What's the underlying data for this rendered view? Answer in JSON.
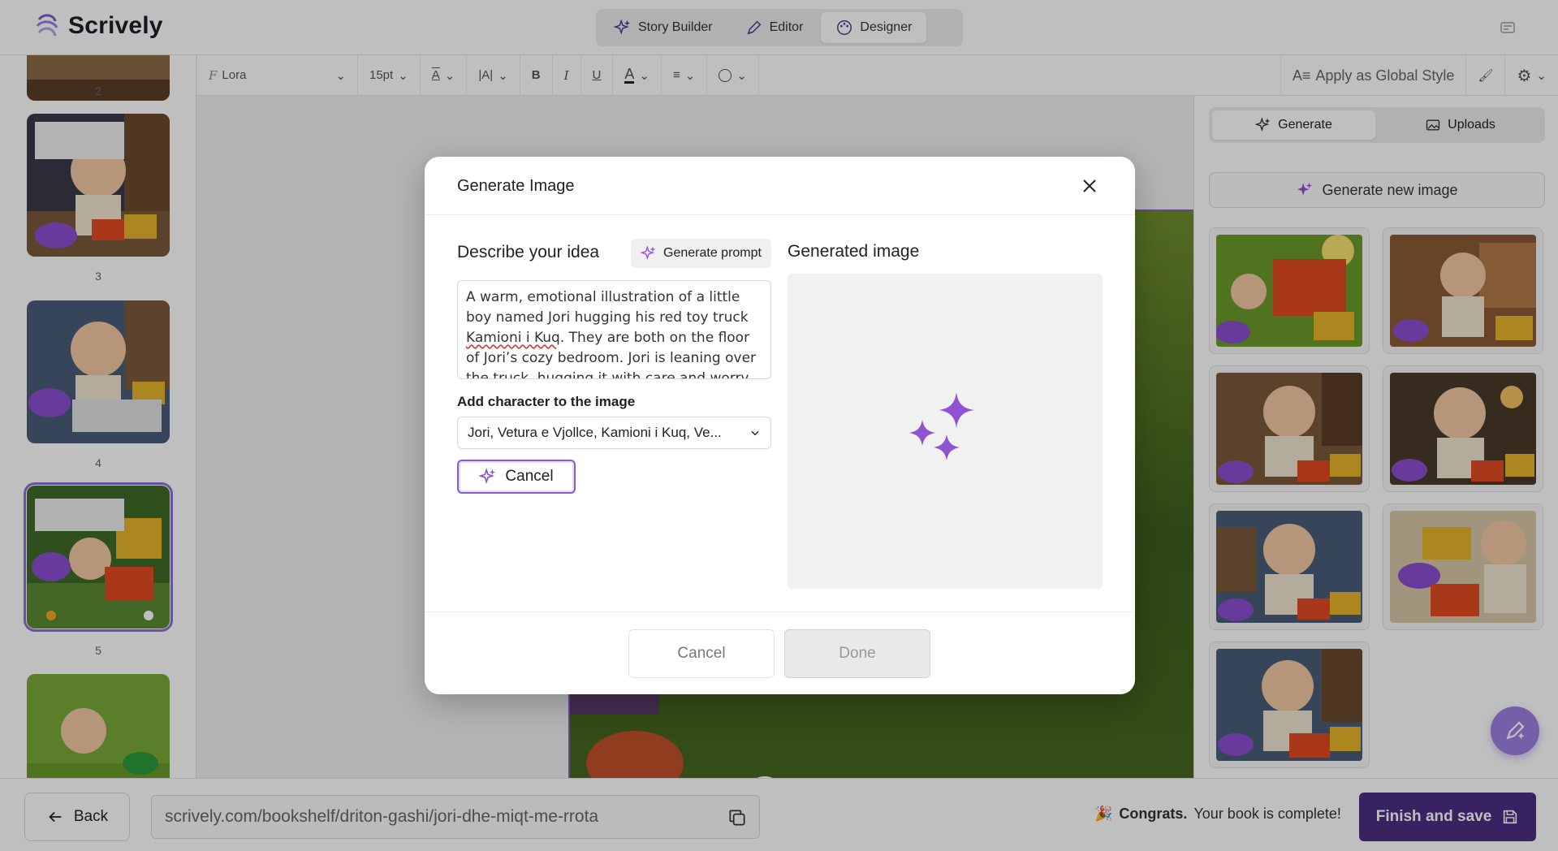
{
  "app": {
    "name": "Scrively"
  },
  "header": {
    "tabs": [
      {
        "label": "Story Builder",
        "icon": "sparkles-icon"
      },
      {
        "label": "Editor",
        "icon": "pen-icon"
      },
      {
        "label": "Designer",
        "icon": "palette-icon",
        "active": true
      }
    ]
  },
  "pages": {
    "numbers": [
      "2",
      "3",
      "4",
      "5"
    ],
    "selected": "5"
  },
  "toolbar": {
    "font": "Lora",
    "size": "15pt",
    "apply_global": "Apply as Global Style"
  },
  "right_panel": {
    "tabs": [
      {
        "label": "Generate",
        "icon": "sparkles-icon",
        "active": true
      },
      {
        "label": "Uploads",
        "icon": "image-icon"
      }
    ],
    "generate_new": "Generate new image",
    "gallery_count": 7
  },
  "bottom": {
    "back": "Back",
    "url": "scrively.com/bookshelf/driton-gashi/jori-dhe-miqt-me-rrota",
    "congrats_bold": "Congrats.",
    "congrats_rest": "Your book is complete!",
    "finish": "Finish and save"
  },
  "modal": {
    "title": "Generate Image",
    "describe_label": "Describe your idea",
    "generate_prompt": "Generate prompt",
    "prompt_part1": "A warm, emotional illustration of a little boy named Jori hugging his red toy truck ",
    "prompt_squiggle": "Kamioni i Kuq",
    "prompt_part2": ". They are both on the floor of Jori’s cozy bedroom. Jori is leaning over the truck, hugging it with care and worry.",
    "add_character_label": "Add character to the image",
    "characters_value": "Jori, Vetura e Vjollce, Kamioni i Kuq, Ve...",
    "cancel_generation": "Cancel",
    "generated_label": "Generated image",
    "cancel": "Cancel",
    "done": "Done"
  },
  "colors": {
    "accent": "#8a5cc9",
    "primary_dark": "#4a2f83",
    "sparkle": "#8e52d2"
  }
}
